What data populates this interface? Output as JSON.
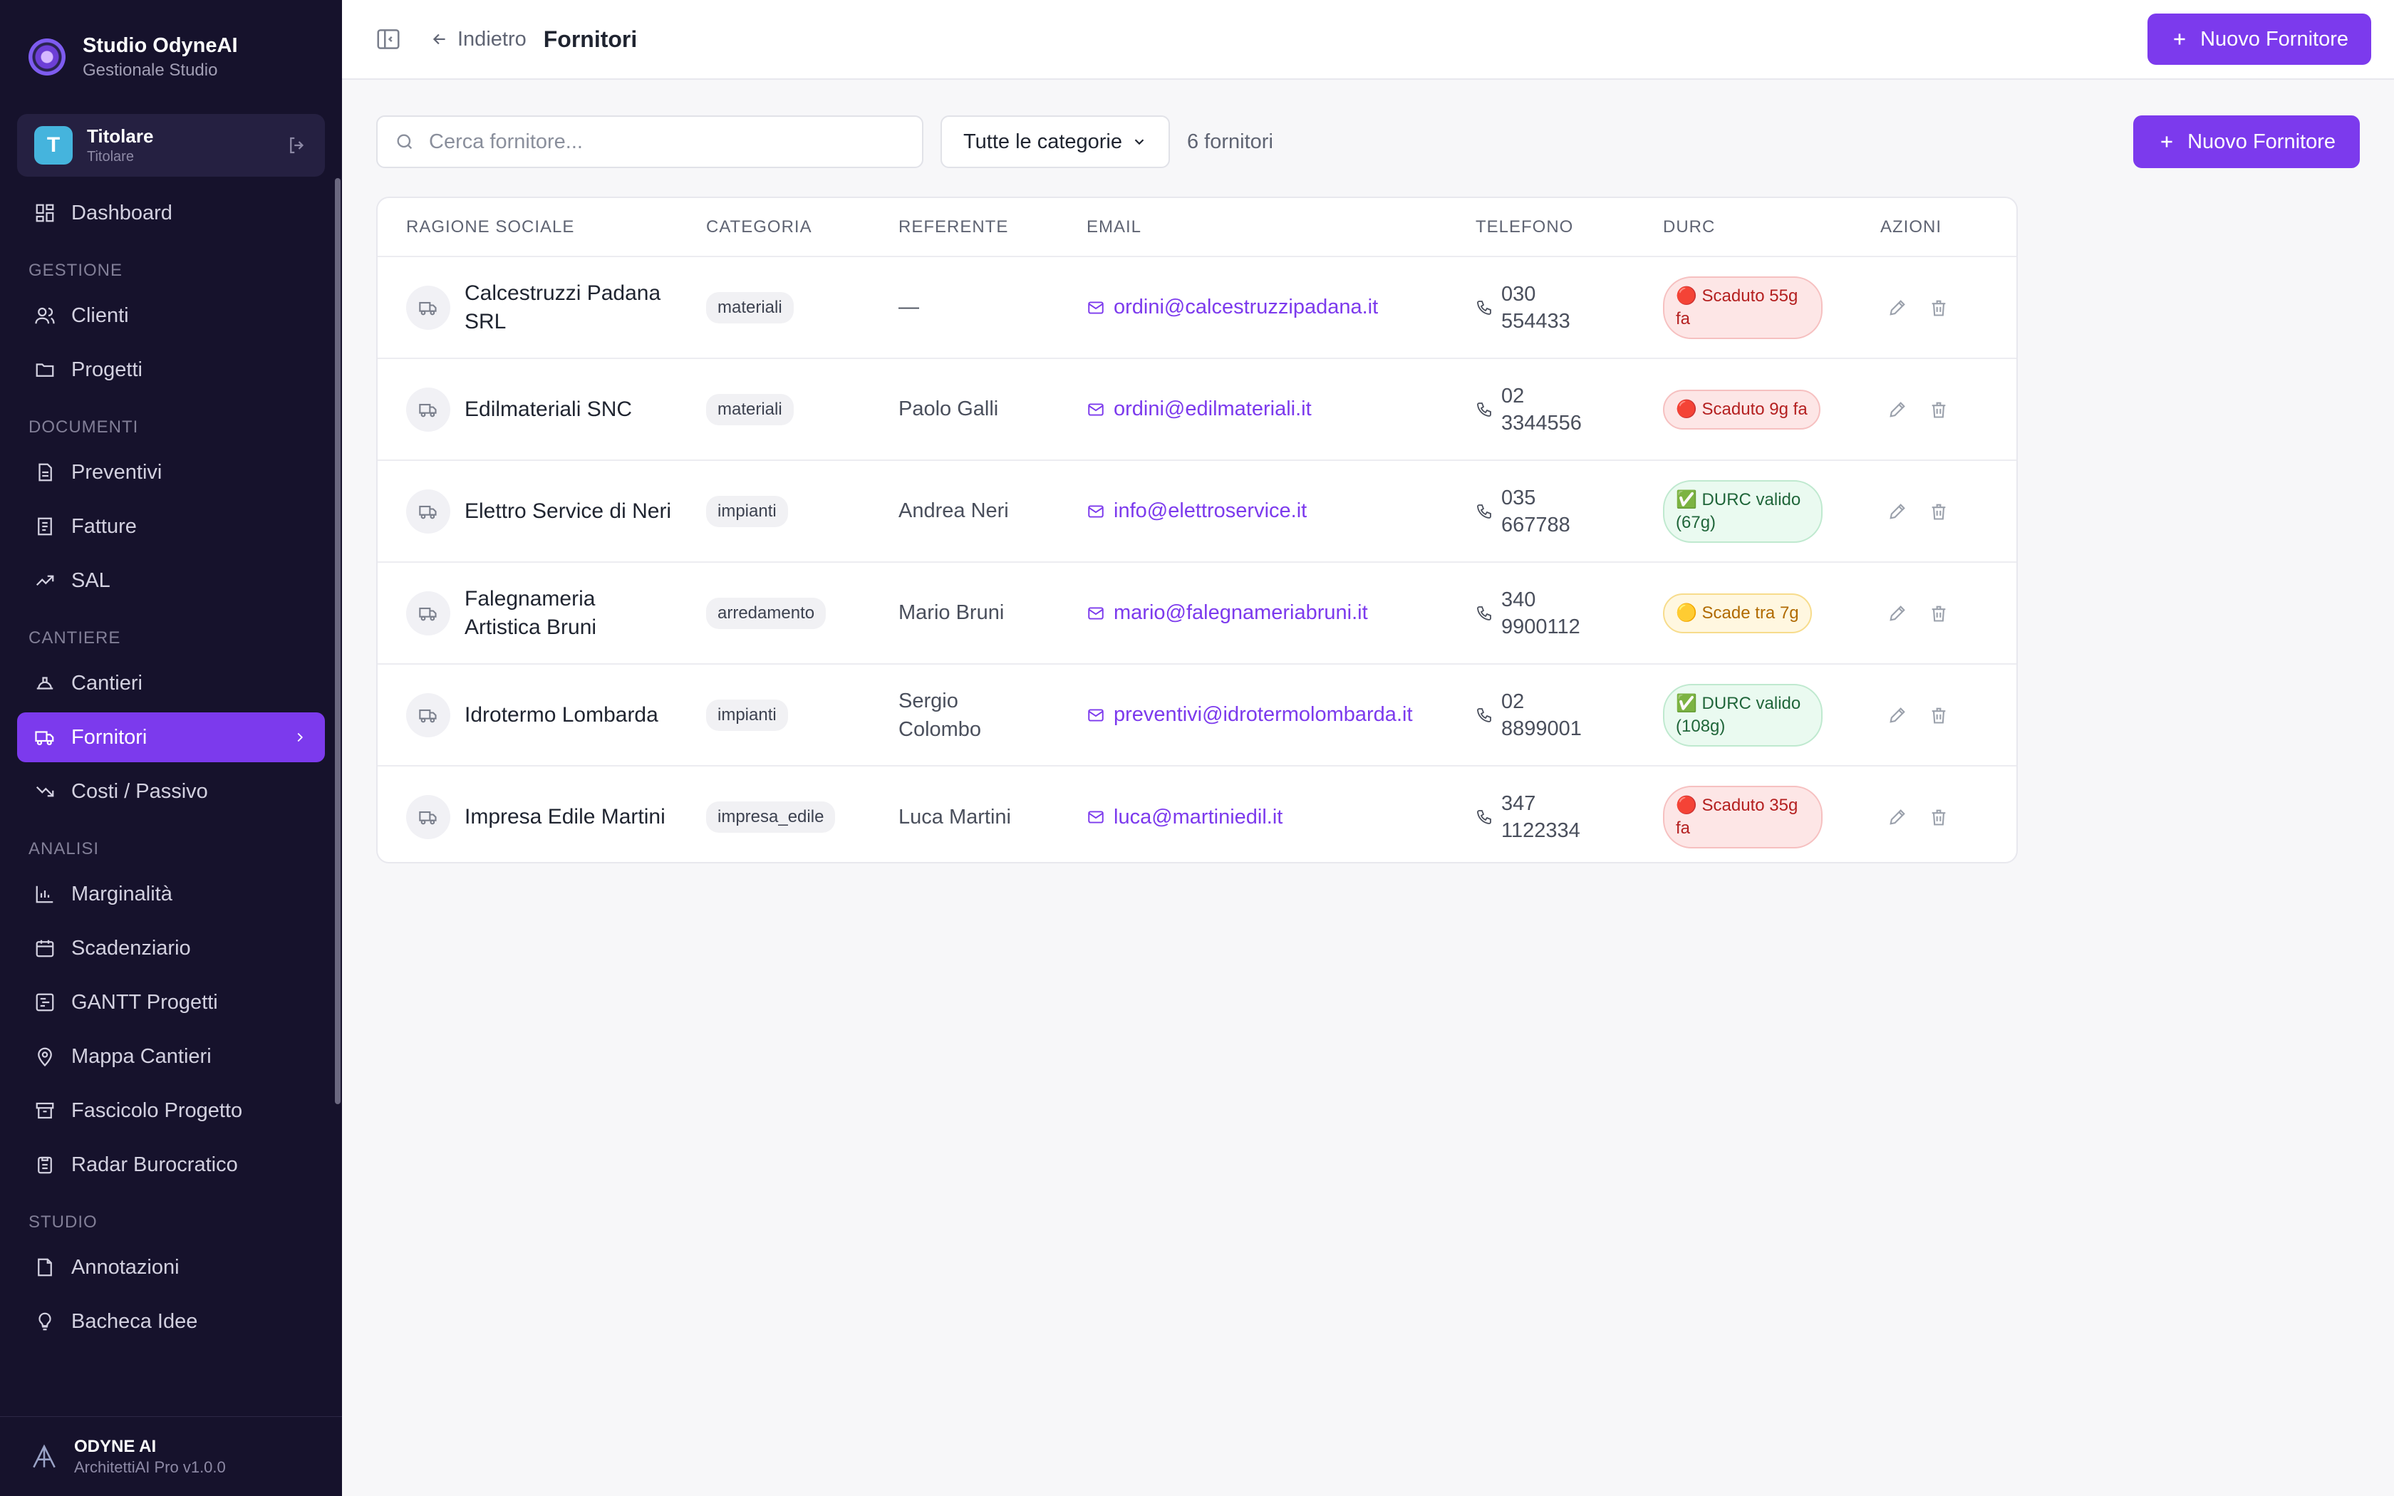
{
  "sidebar": {
    "brand_title": "Studio OdyneAI",
    "brand_subtitle": "Gestionale Studio",
    "user": {
      "initial": "T",
      "name": "Titolare",
      "role": "Titolare"
    },
    "items": {
      "dashboard": "Dashboard",
      "clienti": "Clienti",
      "progetti": "Progetti",
      "preventivi": "Preventivi",
      "fatture": "Fatture",
      "sal": "SAL",
      "cantieri": "Cantieri",
      "fornitori": "Fornitori",
      "costi": "Costi / Passivo",
      "marginalita": "Marginalità",
      "scadenziario": "Scadenziario",
      "gantt": "GANTT Progetti",
      "mappa": "Mappa Cantieri",
      "fascicolo": "Fascicolo Progetto",
      "radar": "Radar Burocratico",
      "annotazioni": "Annotazioni",
      "bacheca": "Bacheca Idee"
    },
    "sections": {
      "gestione": "GESTIONE",
      "documenti": "DOCUMENTI",
      "cantiere": "CANTIERE",
      "analisi": "ANALISI",
      "studio": "STUDIO"
    },
    "footer_title": "ODYNE AI",
    "footer_subtitle": "ArchitettiAI Pro v1.0.0"
  },
  "header": {
    "back_label": "Indietro",
    "title": "Fornitori",
    "new_button": "Nuovo Fornitore"
  },
  "toolbar": {
    "search_placeholder": "Cerca fornitore...",
    "category_selected": "Tutte le categorie",
    "count": "6 fornitori",
    "new_button": "Nuovo Fornitore"
  },
  "table": {
    "columns": [
      "RAGIONE SOCIALE",
      "CATEGORIA",
      "REFERENTE",
      "EMAIL",
      "TELEFONO",
      "DURC",
      "AZIONI"
    ],
    "rows": [
      {
        "name": "Calcestruzzi Padana SRL",
        "category": "materiali",
        "contact": "—",
        "email": "ordini@calcestruzzipadana.it",
        "phone": "030 554433",
        "durc": "🔴 Scaduto 55g fa",
        "durc_status": "red"
      },
      {
        "name": "Edilmateriali SNC",
        "category": "materiali",
        "contact": "Paolo Galli",
        "email": "ordini@edilmateriali.it",
        "phone": "02 3344556",
        "durc": "🔴 Scaduto 9g fa",
        "durc_status": "red"
      },
      {
        "name": "Elettro Service di Neri",
        "category": "impianti",
        "contact": "Andrea Neri",
        "email": "info@elettroservice.it",
        "phone": "035 667788",
        "durc": "✅ DURC valido (67g)",
        "durc_status": "green"
      },
      {
        "name": "Falegnameria Artistica Bruni",
        "category": "arredamento",
        "contact": "Mario Bruni",
        "email": "mario@falegnameriabruni.it",
        "phone": "340 9900112",
        "durc": "🟡 Scade tra 7g",
        "durc_status": "yellow"
      },
      {
        "name": "Idrotermo Lombarda",
        "category": "impianti",
        "contact": "Sergio Colombo",
        "email": "preventivi@idrotermolombarda.it",
        "phone": "02 8899001",
        "durc": "✅ DURC valido (108g)",
        "durc_status": "green"
      },
      {
        "name": "Impresa Edile Martini",
        "category": "impresa_edile",
        "contact": "Luca Martini",
        "email": "luca@martiniedil.it",
        "phone": "347 1122334",
        "durc": "🔴 Scaduto 35g fa",
        "durc_status": "red"
      }
    ]
  },
  "colors": {
    "accent": "#7c3aed",
    "sidebar_bg": "#16122c"
  }
}
